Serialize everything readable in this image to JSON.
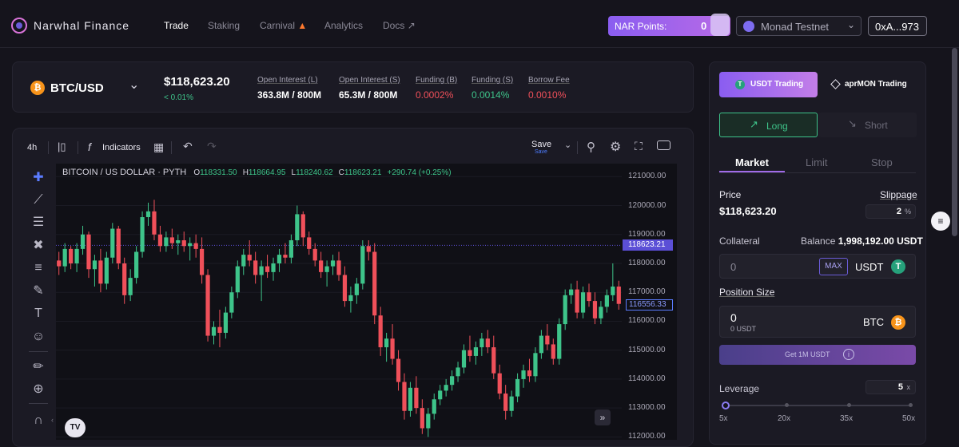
{
  "brand": "Narwhal Finance",
  "nav": [
    "Trade",
    "Staking",
    "Carnival",
    "Analytics",
    "Docs"
  ],
  "nav_icons": {
    "carnival": "fire-icon",
    "docs": "external-link-icon"
  },
  "header": {
    "points_label": "NAR Points:",
    "points_value": "0",
    "network": "Monad Testnet",
    "wallet": "0xA...973"
  },
  "market": {
    "pair": "BTC/USD",
    "price": "$118,623.20",
    "change": "< 0.01%",
    "stats": [
      {
        "label": "Open Interest (L)",
        "value": "363.8M / 800M"
      },
      {
        "label": "Open Interest (S)",
        "value": "65.3M / 800M"
      },
      {
        "label": "Funding (B)",
        "value": "0.0002%"
      },
      {
        "label": "Funding (S)",
        "value": "0.0014%"
      },
      {
        "label": "Borrow Fee",
        "value": "0.0010%"
      }
    ]
  },
  "chart_toolbar": {
    "interval": "4h",
    "indicators": "Indicators",
    "save": "Save",
    "save_sub": "Save"
  },
  "chart_data": {
    "type": "candlestick",
    "title": "BITCOIN / US DOLLAR · PYTH",
    "ohlc_labels": {
      "o": "118331.50",
      "h": "118664.95",
      "l": "118240.62",
      "c": "118623.21",
      "chg": "+290.74 (+0.25%)"
    },
    "y_ticks": [
      121000,
      120000,
      119000,
      118000,
      117000,
      116000,
      115000,
      114000,
      113000,
      112000
    ],
    "y_tick_labels": [
      "121000.00",
      "120000.00",
      "119000.00",
      "118000.00",
      "117000.00",
      "116000.00",
      "115000.00",
      "114000.00",
      "113000.00",
      "112000.00"
    ],
    "ylim": [
      111900,
      121450
    ],
    "price_tag": "118623.21",
    "price_tag_value": 118623.21,
    "secondary_tag": "116556.33",
    "secondary_tag_value": 116556.33,
    "candles": [
      [
        118100,
        118400,
        117600,
        117900
      ],
      [
        117900,
        118700,
        117700,
        118500
      ],
      [
        118500,
        118600,
        117800,
        118000
      ],
      [
        118000,
        118700,
        117700,
        118500
      ],
      [
        118500,
        119300,
        118300,
        119000
      ],
      [
        119000,
        119100,
        117500,
        117800
      ],
      [
        117800,
        118300,
        117200,
        118100
      ],
      [
        118100,
        118500,
        117000,
        117300
      ],
      [
        117300,
        118400,
        117100,
        118200
      ],
      [
        118200,
        119400,
        118000,
        119200
      ],
      [
        119200,
        119300,
        117800,
        118000
      ],
      [
        118000,
        118200,
        116600,
        116900
      ],
      [
        116900,
        117800,
        116700,
        117500
      ],
      [
        117500,
        118600,
        117300,
        118400
      ],
      [
        118400,
        119800,
        118200,
        119600
      ],
      [
        119600,
        120100,
        119300,
        119800
      ],
      [
        119800,
        120200,
        118800,
        119000
      ],
      [
        119000,
        119300,
        118400,
        118600
      ],
      [
        118600,
        119100,
        118400,
        118900
      ],
      [
        118900,
        119200,
        118500,
        118700
      ],
      [
        118700,
        119000,
        118300,
        118800
      ],
      [
        118800,
        119100,
        118400,
        118600
      ],
      [
        118600,
        118900,
        118100,
        118700
      ],
      [
        118700,
        119000,
        118200,
        118500
      ],
      [
        118500,
        118900,
        117300,
        117600
      ],
      [
        117600,
        117800,
        115300,
        115500
      ],
      [
        115500,
        116000,
        115200,
        115800
      ],
      [
        115800,
        116400,
        115100,
        115600
      ],
      [
        115600,
        116500,
        115400,
        116300
      ],
      [
        116300,
        117200,
        116100,
        117000
      ],
      [
        117000,
        118100,
        116800,
        117900
      ],
      [
        117900,
        118500,
        117600,
        118300
      ],
      [
        118300,
        118800,
        117900,
        118100
      ],
      [
        118100,
        118400,
        117300,
        117600
      ],
      [
        117600,
        118100,
        116700,
        117900
      ],
      [
        117900,
        118300,
        117500,
        117700
      ],
      [
        117700,
        118200,
        117400,
        118000
      ],
      [
        118000,
        118500,
        117700,
        118300
      ],
      [
        118300,
        118700,
        118000,
        118200
      ],
      [
        118200,
        119000,
        118000,
        118800
      ],
      [
        118800,
        120000,
        118600,
        119700
      ],
      [
        119700,
        119800,
        118600,
        118900
      ],
      [
        118900,
        119100,
        118300,
        118500
      ],
      [
        118500,
        118700,
        117900,
        118100
      ],
      [
        118100,
        118400,
        117500,
        117700
      ],
      [
        117700,
        118100,
        117200,
        117900
      ],
      [
        117900,
        118300,
        117600,
        118100
      ],
      [
        118100,
        118400,
        117400,
        117600
      ],
      [
        117600,
        117900,
        116500,
        116700
      ],
      [
        116700,
        117200,
        116300,
        116900
      ],
      [
        116900,
        117500,
        116600,
        117300
      ],
      [
        117300,
        118800,
        117100,
        118600
      ],
      [
        118600,
        118800,
        118100,
        118400
      ],
      [
        118400,
        118700,
        115900,
        116200
      ],
      [
        116200,
        116500,
        114800,
        115100
      ],
      [
        115100,
        115600,
        114600,
        115400
      ],
      [
        115400,
        115900,
        114500,
        114700
      ],
      [
        114700,
        115000,
        113600,
        113900
      ],
      [
        113900,
        114200,
        112600,
        112900
      ],
      [
        112900,
        113900,
        112700,
        113700
      ],
      [
        113700,
        114100,
        112800,
        113000
      ],
      [
        113000,
        113300,
        112100,
        112300
      ],
      [
        112300,
        113000,
        112000,
        112800
      ],
      [
        112800,
        113500,
        112600,
        113300
      ],
      [
        113300,
        113800,
        113100,
        113600
      ],
      [
        113600,
        114000,
        113400,
        113800
      ],
      [
        113800,
        114300,
        113600,
        114100
      ],
      [
        114100,
        114600,
        113900,
        114400
      ],
      [
        114400,
        115200,
        114200,
        115000
      ],
      [
        115000,
        115500,
        114600,
        114800
      ],
      [
        114800,
        115300,
        114500,
        115100
      ],
      [
        115100,
        115600,
        114800,
        115400
      ],
      [
        115400,
        115700,
        114900,
        115100
      ],
      [
        115100,
        115500,
        114000,
        114200
      ],
      [
        114200,
        114500,
        113300,
        113500
      ],
      [
        113500,
        113800,
        112600,
        112900
      ],
      [
        112900,
        113600,
        112700,
        113400
      ],
      [
        113400,
        114200,
        113200,
        114000
      ],
      [
        114000,
        114500,
        113700,
        114300
      ],
      [
        114300,
        114700,
        113900,
        114100
      ],
      [
        114100,
        115100,
        113900,
        114900
      ],
      [
        114900,
        115700,
        114700,
        115500
      ],
      [
        115500,
        115900,
        115000,
        115200
      ],
      [
        115200,
        115400,
        114500,
        114700
      ],
      [
        114700,
        116100,
        114500,
        115900
      ],
      [
        115900,
        117100,
        115700,
        116900
      ],
      [
        116900,
        117300,
        116600,
        117100
      ],
      [
        117100,
        117400,
        116100,
        116300
      ],
      [
        116300,
        117200,
        116100,
        117000
      ],
      [
        117000,
        117300,
        116500,
        116700
      ],
      [
        116700,
        117000,
        115900,
        116100
      ],
      [
        116100,
        116700,
        115900,
        116500
      ],
      [
        116500,
        117100,
        116300,
        116900
      ],
      [
        116900,
        118000,
        116700,
        117200
      ],
      [
        117200,
        117400,
        116400,
        116600
      ]
    ]
  },
  "trade_panel": {
    "tab_usdt": "USDT Trading",
    "tab_apr": "aprMON Trading",
    "long": "Long",
    "short": "Short",
    "order_tabs": [
      "Market",
      "Limit",
      "Stop"
    ],
    "price_label": "Price",
    "price_value": "$118,623.20",
    "slippage_label": "Slippage",
    "slippage_value": "2",
    "slippage_unit": "%",
    "collateral_label": "Collateral",
    "balance_label": "Balance",
    "balance_value": "1,998,192.00 USDT",
    "collateral_input": "0",
    "max": "MAX",
    "collateral_token": "USDT",
    "position_label": "Position Size",
    "position_value": "0",
    "position_sub": "0 USDT",
    "position_token": "BTC",
    "get_usdt": "Get 1M USDT",
    "leverage_label": "Leverage",
    "leverage_value": "5",
    "leverage_unit": "x",
    "leverage_marks": [
      "5x",
      "20x",
      "35x",
      "50x"
    ],
    "leverage_fraction": 0
  },
  "colors": {
    "up": "#3ec48a",
    "down": "#f0505a",
    "accent": "#a06be8"
  }
}
